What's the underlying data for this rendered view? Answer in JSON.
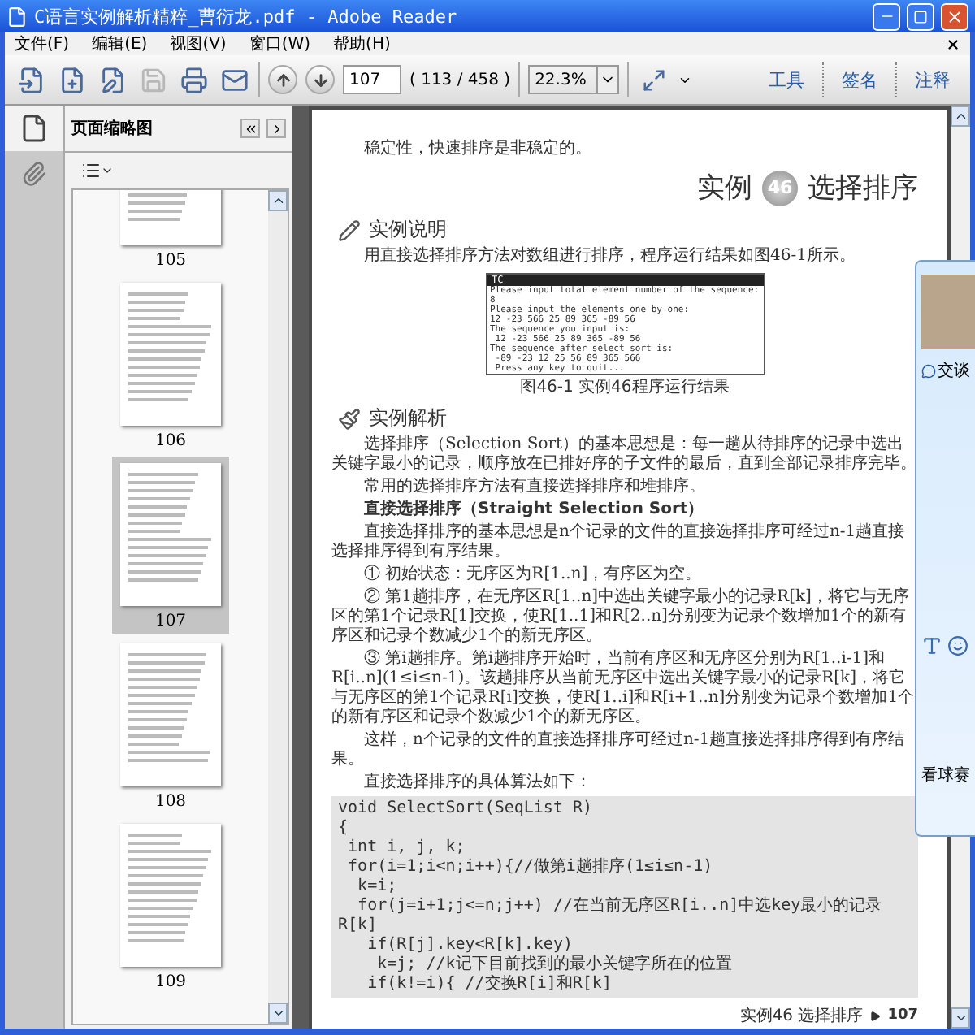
{
  "window": {
    "title": "C语言实例解析精粹_曹衍龙.pdf - Adobe Reader"
  },
  "menu": [
    "文件(F)",
    "编辑(E)",
    "视图(V)",
    "窗口(W)",
    "帮助(H)"
  ],
  "toolbar": {
    "file_buttons": [
      {
        "kind": "open",
        "disabled": false
      },
      {
        "kind": "create",
        "disabled": false
      },
      {
        "kind": "sign",
        "disabled": false
      },
      {
        "kind": "save",
        "disabled": true
      },
      {
        "kind": "print",
        "disabled": false
      },
      {
        "kind": "email",
        "disabled": false
      }
    ],
    "nav_buttons": [
      {
        "kind": "up"
      },
      {
        "kind": "down"
      }
    ],
    "page_field": "107",
    "page_count": "( 113 / 458 )",
    "zoom_field": "22.3%",
    "task_buttons": [
      "工具",
      "签名",
      "注释"
    ]
  },
  "sidebar": {
    "title": "页面缩略图",
    "thumbnails": [
      {
        "label": "105",
        "selected": false
      },
      {
        "label": "106",
        "selected": false
      },
      {
        "label": "107",
        "selected": true
      },
      {
        "label": "108",
        "selected": false
      },
      {
        "label": "109",
        "selected": false
      }
    ]
  },
  "page": {
    "blocks": [
      {
        "kind": "para",
        "text": "稳定性，快速排序是非稳定的。"
      },
      {
        "kind": "chapter",
        "prefix": "实例",
        "number": "46",
        "title": "选择排序"
      },
      {
        "kind": "section",
        "title": "实例说明"
      },
      {
        "kind": "para",
        "text": "用直接选择排序方法对数组进行排序，程序运行结果如图46-1所示。"
      },
      {
        "kind": "terminal",
        "title": "TC",
        "lines": [
          "Please input total element number of the sequence:",
          "8",
          "Please input the elements one by one:",
          "12 -23 566 25 89 365 -89 56",
          "The sequence you input is:",
          " 12 -23 566 25 89 365 -89 56",
          "The sequence after select sort is:",
          " -89 -23 12 25 56 89 365 566",
          " Press any key to quit..."
        ]
      },
      {
        "kind": "caption",
        "text": "图46-1 实例46程序运行结果"
      },
      {
        "kind": "section",
        "title": "实例解析"
      },
      {
        "kind": "para",
        "text": "选择排序（Selection Sort）的基本思想是：每一趟从待排序的记录中选出关键字最小的记录，顺序放在已排好序的子文件的最后，直到全部记录排序完毕。"
      },
      {
        "kind": "para",
        "text": "常用的选择排序方法有直接选择排序和堆排序。"
      },
      {
        "kind": "subheading",
        "text": "直接选择排序（Straight Selection Sort）"
      },
      {
        "kind": "para",
        "text": "直接选择排序的基本思想是n个记录的文件的直接选择排序可经过n-1趟直接选择排序得到有序结果。"
      },
      {
        "kind": "para",
        "text": "① 初始状态：无序区为R[1..n]，有序区为空。"
      },
      {
        "kind": "para",
        "text": "② 第1趟排序，在无序区R[1..n]中选出关键字最小的记录R[k]，将它与无序区的第1个记录R[1]交换，使R[1..1]和R[2..n]分别变为记录个数增加1个的新有序区和记录个数减少1个的新无序区。"
      },
      {
        "kind": "para",
        "text": "③ 第i趟排序。第i趟排序开始时，当前有序区和无序区分别为R[1..i-1]和R[i..n](1≤i≤n-1)。该趟排序从当前无序区中选出关键字最小的记录R[k]，将它与无序区的第1个记录R[i]交换，使R[1..i]和R[i+1..n]分别变为记录个数增加1个的新有序区和记录个数减少1个的新无序区。"
      },
      {
        "kind": "para",
        "text": "这样，n个记录的文件的直接选择排序可经过n-1趟直接选择排序得到有序结果。"
      },
      {
        "kind": "para",
        "text": "直接选择排序的具体算法如下："
      },
      {
        "kind": "code",
        "lines": [
          "void SelectSort(SeqList R)",
          "{",
          " int i, j, k;",
          " for(i=1;i<n;i++){//做第i趟排序(1≤i≤n-1)",
          "  k=i;",
          "  for(j=i+1;j<=n;j++) //在当前无序区R[i..n]中选key最小的记录R[k]",
          "   if(R[j].key<R[k].key)",
          "    k=j; //k记下目前找到的最小关键字所在的位置",
          "   if(k!=i){ //交换R[i]和R[k]"
        ]
      },
      {
        "kind": "footer",
        "text": "实例46 选择排序",
        "page": "107"
      }
    ]
  },
  "chat_popup": {
    "action": "交谈",
    "message": "看球赛"
  }
}
